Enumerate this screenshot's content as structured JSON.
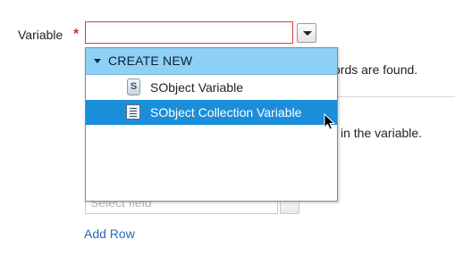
{
  "form": {
    "variable_label": "Variable",
    "required_mark": "*",
    "variable_value": "",
    "add_row_label": "Add Row",
    "field_placeholder": "Select field"
  },
  "background_text": {
    "line1": "cords are found.",
    "line2": "in the variable."
  },
  "dropdown": {
    "header": "CREATE NEW",
    "items": [
      {
        "label": "SObject Variable",
        "icon": "sobject-variable-icon",
        "selected": false
      },
      {
        "label": "SObject Collection Variable",
        "icon": "sobject-collection-icon",
        "selected": true
      }
    ]
  },
  "colors": {
    "header_bg": "#8fd0f6",
    "selected_bg": "#1b8edb",
    "required": "#c23934",
    "link": "#2a6ab8",
    "error_border": "#e03a3a"
  }
}
